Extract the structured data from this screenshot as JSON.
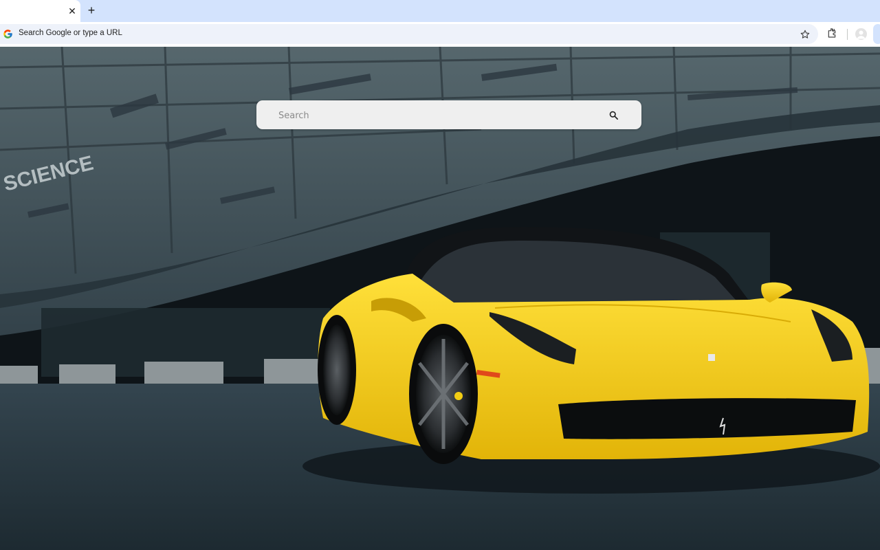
{
  "browser": {
    "omnibox_placeholder": "Search Google or type a URL",
    "tab_close_glyph": "✕",
    "new_tab_glyph": "+",
    "icons": [
      "google-g-icon",
      "bookmark-star-icon",
      "extensions-icon",
      "profile-icon"
    ],
    "colors": {
      "tabstrip": "#d3e3fd",
      "omnibox": "#eef2fa"
    }
  },
  "page": {
    "search": {
      "placeholder": "Search"
    },
    "background": {
      "subject": "yellow sports car",
      "wall_text": "SCIENCE"
    },
    "colors": {
      "car": "#f2cd14",
      "wall": "#46545a",
      "ground": "#2c3c45"
    }
  }
}
